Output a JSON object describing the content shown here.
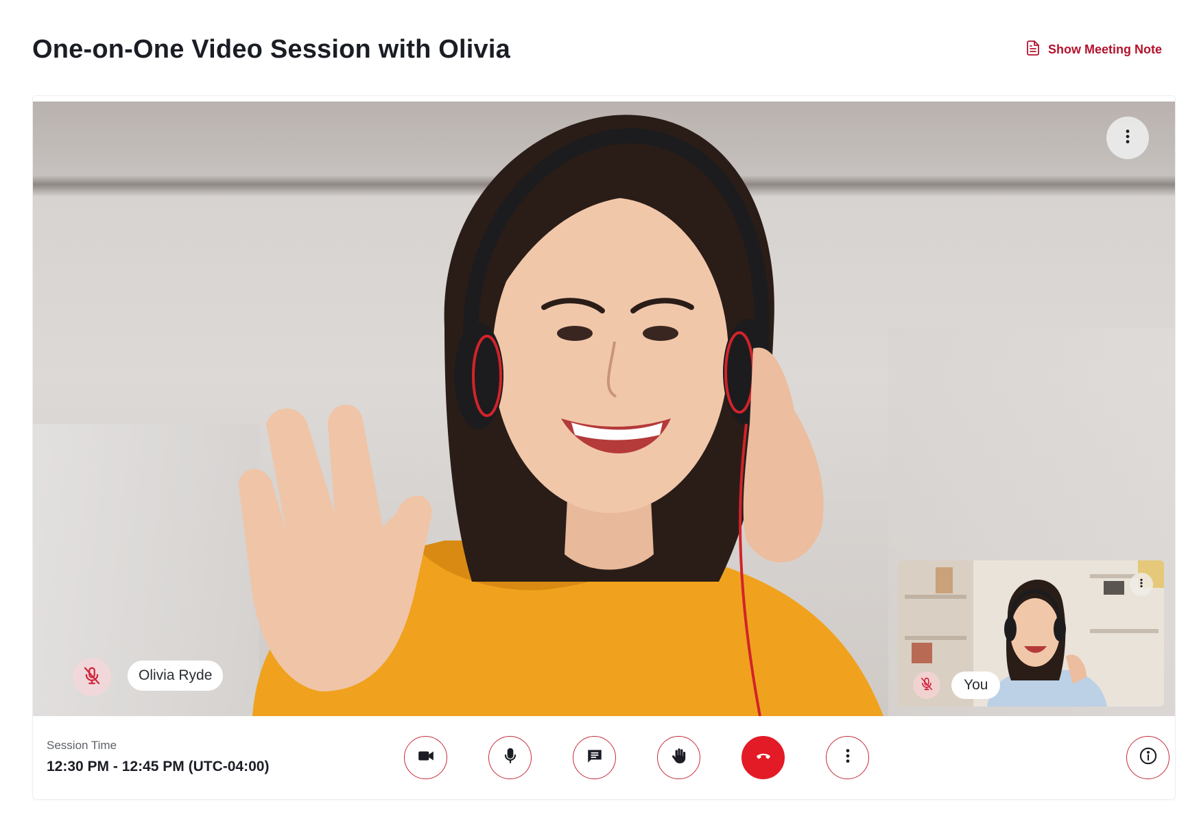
{
  "header": {
    "title": "One-on-One Video Session with Olivia",
    "meeting_note_label": "Show Meeting Note",
    "meeting_note_icon": "document-icon"
  },
  "main_video": {
    "participant_name": "Olivia Ryde",
    "muted": true,
    "mute_icon": "mic-off-icon",
    "options_icon": "more-vertical-icon"
  },
  "self_view": {
    "participant_name": "You",
    "muted": true,
    "mute_icon": "mic-off-icon",
    "options_icon": "more-vertical-icon"
  },
  "session": {
    "label": "Session Time",
    "time": "12:30 PM - 12:45 PM (UTC-04:00)"
  },
  "controls": [
    {
      "name": "camera-button",
      "icon": "video-camera-icon"
    },
    {
      "name": "microphone-button",
      "icon": "microphone-icon"
    },
    {
      "name": "chat-button",
      "icon": "chat-icon"
    },
    {
      "name": "raise-hand-button",
      "icon": "hand-icon"
    },
    {
      "name": "end-call-button",
      "icon": "phone-hangup-icon"
    },
    {
      "name": "more-options-button",
      "icon": "more-vertical-icon"
    }
  ],
  "info_button": {
    "icon": "info-icon"
  },
  "colors": {
    "accent": "#c42a3a",
    "end_call": "#e21b26",
    "title_text": "#1a1d24",
    "note_link": "#b3122c"
  }
}
